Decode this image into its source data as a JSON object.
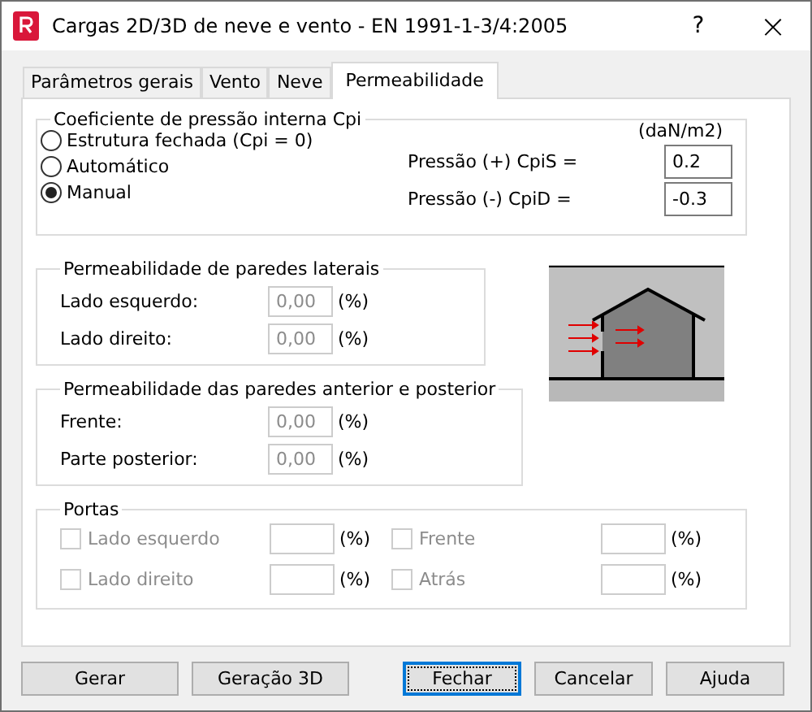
{
  "window": {
    "title": "Cargas 2D/3D de neve e vento - EN 1991-1-3/4:2005",
    "help": "?",
    "close": "×"
  },
  "tabs": [
    {
      "label": "Parâmetros gerais",
      "selected": false
    },
    {
      "label": "Vento",
      "selected": false
    },
    {
      "label": "Neve",
      "selected": false
    },
    {
      "label": "Permeabilidade",
      "selected": true
    }
  ],
  "cpi": {
    "title": "Coeficiente de pressão interna Cpi",
    "unit": "(daN/m2)",
    "options": [
      {
        "label": "Estrutura fechada (Cpi = 0)",
        "selected": false
      },
      {
        "label": "Automático",
        "selected": false
      },
      {
        "label": "Manual",
        "selected": true
      }
    ],
    "fields": [
      {
        "label": "Pressão (+) CpiS =",
        "value": "0.2",
        "disabled": false
      },
      {
        "label": "Pressão (-) CpiD =",
        "value": "-0.3",
        "disabled": false
      }
    ]
  },
  "groups": [
    {
      "title": "Permeabilidade de paredes laterais",
      "fields": [
        {
          "label": "Lado esquerdo:",
          "value": "0,00",
          "unit": "(%)",
          "disabled": true
        },
        {
          "label": "Lado direito:",
          "value": "0,00",
          "unit": "(%)",
          "disabled": true
        }
      ]
    },
    {
      "title": "Permeabilidade das paredes anterior e posterior",
      "fields": [
        {
          "label": "Frente:",
          "value": "0,00",
          "unit": "(%)",
          "disabled": true
        },
        {
          "label": "Parte posterior:",
          "value": "0,00",
          "unit": "(%)",
          "disabled": true
        }
      ]
    }
  ],
  "doors": {
    "title": "Portas",
    "items": [
      {
        "label": "Lado esquerdo",
        "unit": "(%)",
        "checked": false,
        "disabled": true
      },
      {
        "label": "Frente",
        "unit": "(%)",
        "checked": false,
        "disabled": true
      },
      {
        "label": "Lado direito",
        "unit": "(%)",
        "checked": false,
        "disabled": true
      },
      {
        "label": "Atrás",
        "unit": "(%)",
        "checked": false,
        "disabled": true
      }
    ]
  },
  "buttons": [
    {
      "label": "Gerar",
      "default": false
    },
    {
      "label": "Geração 3D",
      "default": false
    },
    {
      "label": "Fechar",
      "default": true
    },
    {
      "label": "Cancelar",
      "default": false
    },
    {
      "label": "Ajuda",
      "default": false
    }
  ]
}
